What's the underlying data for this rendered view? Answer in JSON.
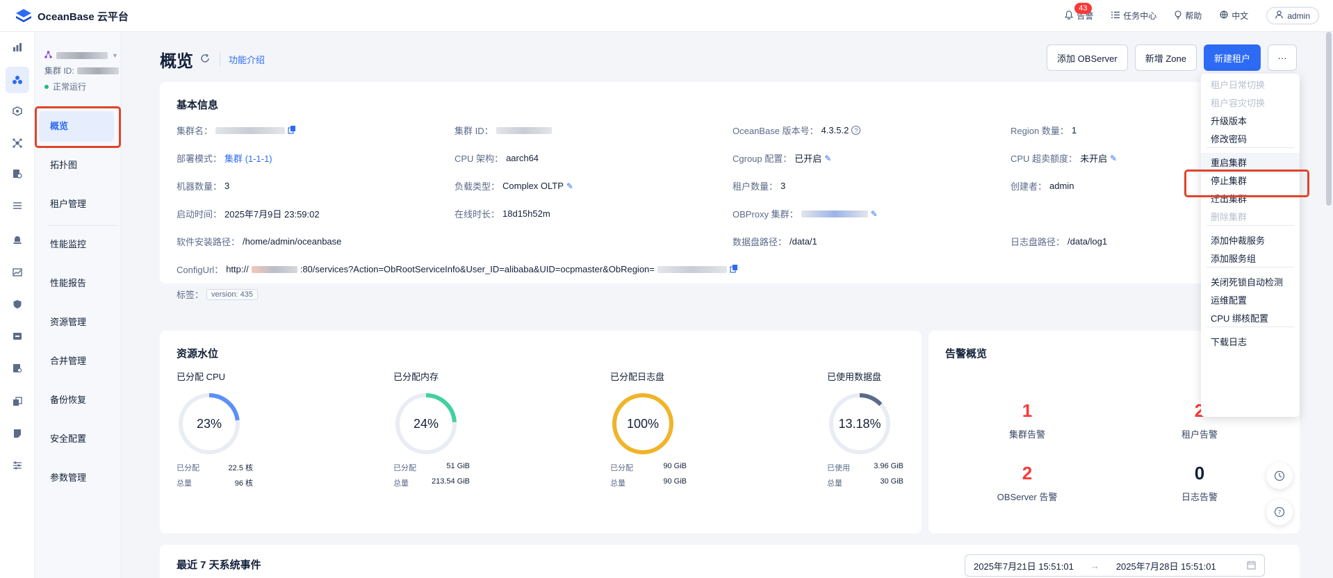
{
  "app": {
    "title": "OceanBase 云平台"
  },
  "topbar": {
    "alarm_label": "告警",
    "alarm_count": "43",
    "tasks_label": "任务中心",
    "help_label": "帮助",
    "lang_label": "中文",
    "user_label": "admin"
  },
  "cluster": {
    "id_label": "集群 ID:",
    "status": "正常运行"
  },
  "subnav": {
    "items": [
      "概览",
      "拓扑图",
      "租户管理",
      "性能监控",
      "性能报告",
      "资源管理",
      "合并管理",
      "备份恢复",
      "安全配置",
      "参数管理"
    ]
  },
  "page": {
    "title": "概览",
    "intro_link": "功能介绍",
    "actions": {
      "add_observer": "添加 OBServer",
      "add_zone": "新增 Zone",
      "new_tenant": "新建租户",
      "more": "···"
    }
  },
  "basic_info": {
    "title": "基本信息",
    "cluster_name_label": "集群名：",
    "cluster_id_label": "集群 ID：",
    "ob_version_label": "OceanBase 版本号：",
    "ob_version": "4.3.5.2",
    "region_label": "Region 数量：",
    "region_count": "1",
    "deploy_mode_label": "部署模式：",
    "deploy_mode": "集群 (1-1-1)",
    "cpu_arch_label": "CPU 架构：",
    "cpu_arch": "aarch64",
    "cgroup_label": "Cgroup 配置：",
    "cgroup": "已开启",
    "cpu_over_label": "CPU 超卖额度：",
    "cpu_over": "未开启",
    "machine_label": "机器数量：",
    "machine_count": "3",
    "load_type_label": "负载类型：",
    "load_type": "Complex OLTP",
    "tenant_label": "租户数量：",
    "tenant_count": "3",
    "creator_label": "创建者：",
    "creator": "admin",
    "start_time_label": "启动时间：",
    "start_time": "2025年7月9日 23:59:02",
    "uptime_label": "在线时长：",
    "uptime": "18d15h52m",
    "obproxy_label": "OBProxy 集群：",
    "install_path_label": "软件安装路径：",
    "install_path": "/home/admin/oceanbase",
    "data_path_label": "数据盘路径：",
    "data_path": "/data/1",
    "log_path_label": "日志盘路径：",
    "log_path": "/data/log1",
    "config_url_label": "ConfigUrl：",
    "config_url_prefix": "http://",
    "config_url_mid": ":80/services?Action=ObRootServiceInfo&User_ID=alibaba&UID=ocpmaster&ObRegion=",
    "tags_label": "标签：",
    "tag": "version: 435"
  },
  "resource": {
    "title": "资源水位",
    "gauges": [
      {
        "title": "已分配 CPU",
        "percent": "23%",
        "fraction": 0.23,
        "color": "#5b8ff9",
        "l1": "已分配",
        "v1": "22.5 核",
        "l2": "总量",
        "v2": "96 核"
      },
      {
        "title": "已分配内存",
        "percent": "24%",
        "fraction": 0.24,
        "color": "#3fd19e",
        "l1": "已分配",
        "v1": "51 GiB",
        "l2": "总量",
        "v2": "213.54 GiB"
      },
      {
        "title": "已分配日志盘",
        "percent": "100%",
        "fraction": 1.0,
        "color": "#f0b429",
        "l1": "已分配",
        "v1": "90 GiB",
        "l2": "总量",
        "v2": "90 GiB"
      },
      {
        "title": "已使用数据盘",
        "percent": "13.18%",
        "fraction": 0.1318,
        "color": "#5c6b8a",
        "l1": "已使用",
        "v1": "3.96 GiB",
        "l2": "总量",
        "v2": "30 GiB"
      }
    ]
  },
  "alarms": {
    "title": "告警概览",
    "cells": [
      {
        "num": "1",
        "label": "集群告警",
        "color": "#f93939"
      },
      {
        "num": "2",
        "label": "租户告警",
        "color": "#f93939"
      },
      {
        "num": "2",
        "label": "OBServer 告警",
        "color": "#f93939"
      },
      {
        "num": "0",
        "label": "日志告警",
        "color": "#132039"
      }
    ]
  },
  "events": {
    "title": "最近 7 天系统事件",
    "start": "2025年7月21日 15:51:01",
    "end": "2025年7月28日 15:51:01",
    "arrow": "→"
  },
  "dropdown": {
    "items": [
      {
        "label": "租户日常切换",
        "disabled": true
      },
      {
        "label": "租户容灾切换",
        "disabled": true
      },
      {
        "label": "升级版本",
        "disabled": false
      },
      {
        "label": "修改密码",
        "disabled": false
      },
      {
        "label": "重启集群",
        "disabled": false
      },
      {
        "label": "停止集群",
        "disabled": false
      },
      {
        "label": "迁出集群",
        "disabled": false
      },
      {
        "label": "删除集群",
        "disabled": true
      },
      {
        "label": "添加仲裁服务",
        "disabled": false
      },
      {
        "label": "添加服务组",
        "disabled": false
      },
      {
        "label": "关闭死锁自动检测",
        "disabled": false
      },
      {
        "label": "运维配置",
        "disabled": false
      },
      {
        "label": "CPU 绑核配置",
        "disabled": false
      },
      {
        "label": "下载日志",
        "disabled": false
      }
    ]
  }
}
